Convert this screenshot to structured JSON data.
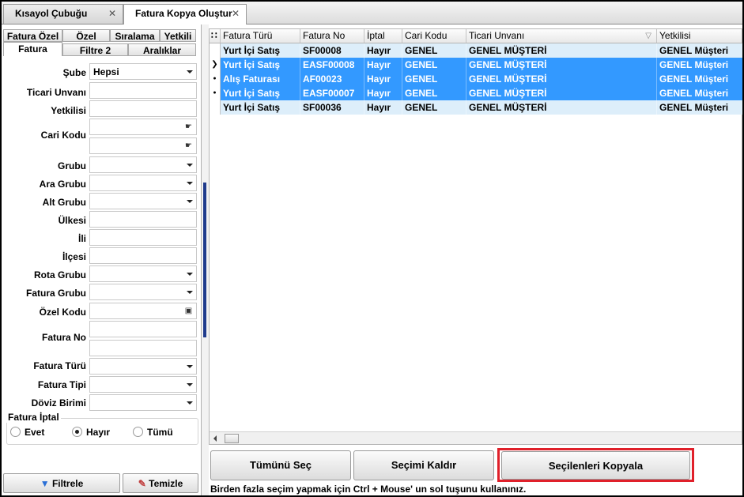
{
  "tabs": [
    {
      "label": "Kısayol Çubuğu"
    },
    {
      "label": "Fatura Kopya Oluştur"
    }
  ],
  "filter_tabs": {
    "row1": [
      "Fatura Özel",
      "Özel",
      "Sıralama",
      "Yetkili"
    ],
    "row2": [
      "Fatura",
      "Filtre 2",
      "Aralıklar"
    ]
  },
  "filters": {
    "sube": {
      "label": "Şube",
      "value": "Hepsi"
    },
    "ticari_unvani": {
      "label": "Ticari Unvanı"
    },
    "yetkilisi": {
      "label": "Yetkilisi"
    },
    "cari_kodu": {
      "label": "Cari Kodu"
    },
    "grubu": {
      "label": "Grubu"
    },
    "ara_grubu": {
      "label": "Ara Grubu"
    },
    "alt_grubu": {
      "label": "Alt Grubu"
    },
    "ulkesi": {
      "label": "Ülkesi"
    },
    "ili": {
      "label": "İli"
    },
    "ilcesi": {
      "label": "İlçesi"
    },
    "rota_grubu": {
      "label": "Rota Grubu"
    },
    "fatura_grubu": {
      "label": "Fatura Grubu"
    },
    "ozel_kodu": {
      "label": "Özel Kodu"
    },
    "fatura_no": {
      "label": "Fatura No"
    },
    "fatura_turu": {
      "label": "Fatura Türü"
    },
    "fatura_tipi": {
      "label": "Fatura Tipi"
    },
    "doviz_birimi": {
      "label": "Döviz Birimi"
    }
  },
  "fatura_iptal": {
    "title": "Fatura İptal",
    "options": [
      "Evet",
      "Hayır",
      "Tümü"
    ],
    "selected": "Hayır"
  },
  "left_buttons": {
    "filter": "Filtrele",
    "clear": "Temizle"
  },
  "grid": {
    "columns": [
      "Fatura Türü",
      "Fatura No",
      "İptal",
      "Cari Kodu",
      "Ticari Unvanı",
      "Yetkilisi"
    ],
    "rows": [
      {
        "tur": "Yurt İçi Satış",
        "no": "SF00008",
        "iptal": "Hayır",
        "cari": "GENEL",
        "unvan": "GENEL MÜŞTERİ",
        "yetkili": "GENEL Müşteri",
        "selected": false,
        "indicator": ""
      },
      {
        "tur": "Yurt İçi Satış",
        "no": "EASF00008",
        "iptal": "Hayır",
        "cari": "GENEL",
        "unvan": "GENEL MÜŞTERİ",
        "yetkili": "GENEL Müşteri",
        "selected": true,
        "indicator": "current"
      },
      {
        "tur": "Alış Faturası",
        "no": "AF00023",
        "iptal": "Hayır",
        "cari": "GENEL",
        "unvan": "GENEL MÜŞTERİ",
        "yetkili": "GENEL Müşteri",
        "selected": true,
        "indicator": "dot"
      },
      {
        "tur": "Yurt İçi Satış",
        "no": "EASF00007",
        "iptal": "Hayır",
        "cari": "GENEL",
        "unvan": "GENEL MÜŞTERİ",
        "yetkili": "GENEL Müşteri",
        "selected": true,
        "indicator": "dot"
      },
      {
        "tur": "Yurt İçi Satış",
        "no": "SF00036",
        "iptal": "Hayır",
        "cari": "GENEL",
        "unvan": "GENEL MÜŞTERİ",
        "yetkili": "GENEL Müşteri",
        "selected": false,
        "indicator": ""
      }
    ]
  },
  "actions": {
    "select_all": "Tümünü Seç",
    "deselect": "Seçimi Kaldır",
    "copy_selected": "Seçilenleri Kopyala"
  },
  "hint": "Birden fazla seçim yapmak için Ctrl + Mouse' un sol tuşunu kullanınız.",
  "colors": {
    "selected_row": "#3399ff",
    "light_row": "#ddeefa",
    "highlight_box": "#e0202a"
  }
}
